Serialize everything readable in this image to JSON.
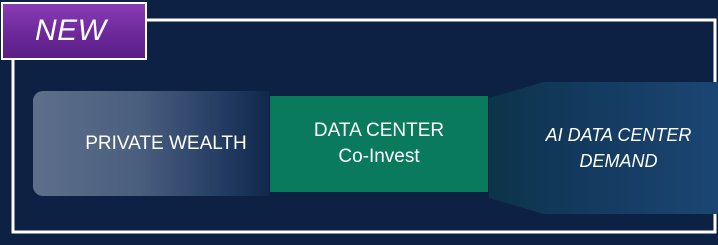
{
  "badge": {
    "label": "NEW"
  },
  "flow": {
    "private_wealth": "PRIVATE WEALTH",
    "data_center_line1": "DATA CENTER",
    "data_center_line2": "Co-Invest",
    "ai_line1": "AI DATA CENTER",
    "ai_line2": "DEMAND"
  },
  "colors": {
    "background": "#0c2143",
    "badge": "#6a2797",
    "data_center": "#0a7a5c",
    "frame_line": "#ffffff"
  }
}
